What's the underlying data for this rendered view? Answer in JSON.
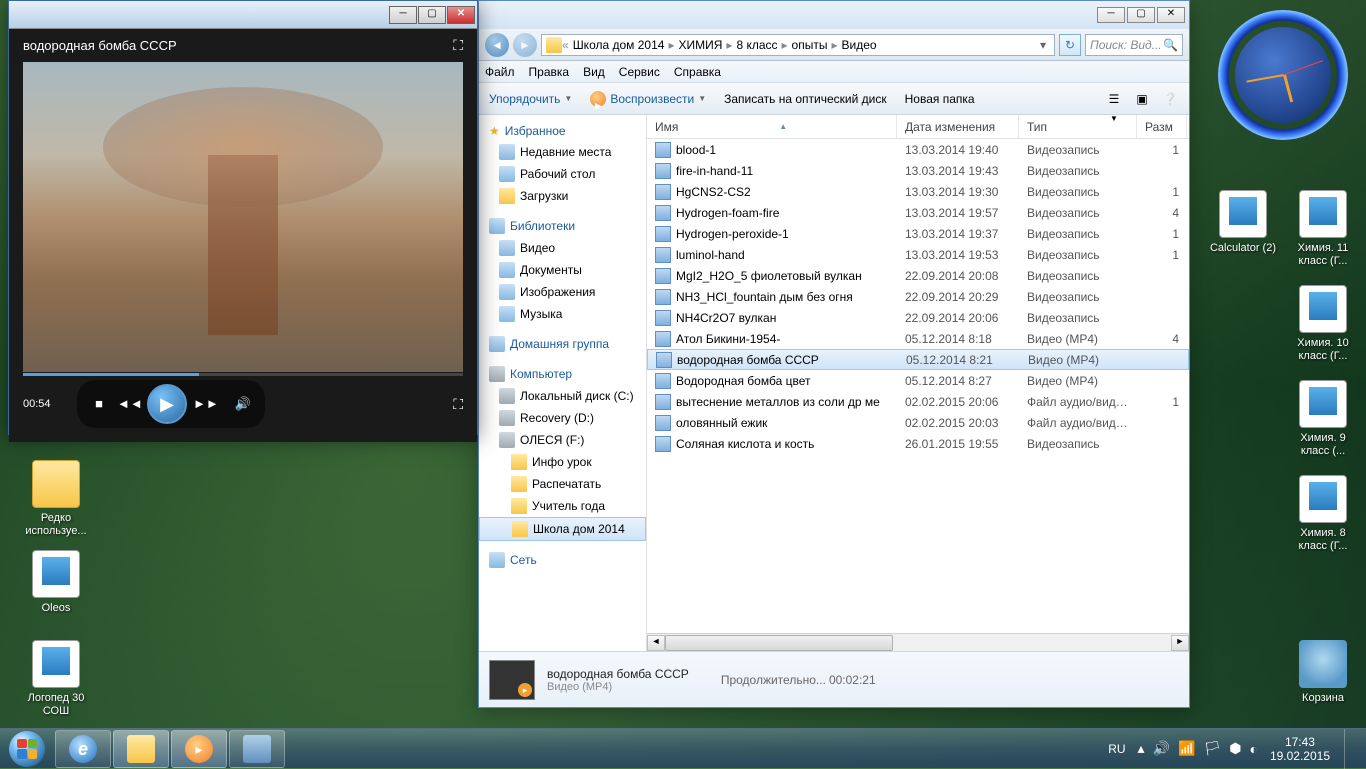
{
  "desktop_icons": {
    "rarely_used": "Редко используе...",
    "oleos": "Oleos",
    "logoped": "Логопед 30 СОШ",
    "calculator": "Calculator (2)",
    "chem11": "Химия. 11 класс (Г...",
    "chem10": "Химия. 10 класс (Г...",
    "chem9": "Химия. 9 класс (...",
    "chem8": "Химия. 8 класс (Г...",
    "recycle": "Корзина"
  },
  "wmp": {
    "title": "водородная бомба СССР",
    "time": "00:54"
  },
  "explorer": {
    "breadcrumbs": [
      "Школа дом 2014",
      "ХИМИЯ",
      "8 класс",
      "опыты",
      "Видео"
    ],
    "search_placeholder": "Поиск: Вид...",
    "menu": [
      "Файл",
      "Правка",
      "Вид",
      "Сервис",
      "Справка"
    ],
    "toolbar": {
      "organize": "Упорядочить",
      "play": "Воспроизвести",
      "burn": "Записать на оптический диск",
      "new_folder": "Новая папка"
    },
    "tree": {
      "favorites": "Избранное",
      "recent": "Недавние места",
      "desktop": "Рабочий стол",
      "downloads": "Загрузки",
      "libraries": "Библиотеки",
      "video": "Видео",
      "documents": "Документы",
      "pictures": "Изображения",
      "music": "Музыка",
      "homegroup": "Домашняя группа",
      "computer": "Компьютер",
      "drive_c": "Локальный диск (C:)",
      "drive_d": "Recovery (D:)",
      "drive_f": "ОЛЕСЯ (F:)",
      "f1": "Инфо урок",
      "f2": "Распечатать",
      "f3": "Учитель года",
      "f4": "Школа дом 2014",
      "network": "Сеть"
    },
    "cols": {
      "name": "Имя",
      "date": "Дата изменения",
      "type": "Тип",
      "size": "Разм"
    },
    "files": [
      {
        "name": "blood-1",
        "date": "13.03.2014 19:40",
        "type": "Видеозапись",
        "size": "1"
      },
      {
        "name": "fire-in-hand-11",
        "date": "13.03.2014 19:43",
        "type": "Видеозапись",
        "size": ""
      },
      {
        "name": "HgCNS2-CS2",
        "date": "13.03.2014 19:30",
        "type": "Видеозапись",
        "size": "1"
      },
      {
        "name": "Hydrogen-foam-fire",
        "date": "13.03.2014 19:57",
        "type": "Видеозапись",
        "size": "4"
      },
      {
        "name": "Hydrogen-peroxide-1",
        "date": "13.03.2014 19:37",
        "type": "Видеозапись",
        "size": "1"
      },
      {
        "name": "luminol-hand",
        "date": "13.03.2014 19:53",
        "type": "Видеозапись",
        "size": "1"
      },
      {
        "name": "MgI2_H2O_5 фиолетовый вулкан",
        "date": "22.09.2014 20:08",
        "type": "Видеозапись",
        "size": ""
      },
      {
        "name": "NH3_HCl_fountain дым без огня",
        "date": "22.09.2014 20:29",
        "type": "Видеозапись",
        "size": ""
      },
      {
        "name": "NH4Cr2O7  вулкан",
        "date": "22.09.2014 20:06",
        "type": "Видеозапись",
        "size": ""
      },
      {
        "name": "Атол Бикини-1954-",
        "date": "05.12.2014 8:18",
        "type": "Видео (MP4)",
        "size": "4"
      },
      {
        "name": "водородная бомба СССР",
        "date": "05.12.2014 8:21",
        "type": "Видео (MP4)",
        "size": "",
        "sel": true
      },
      {
        "name": "Водородная бомба цвет",
        "date": "05.12.2014 8:27",
        "type": "Видео (MP4)",
        "size": ""
      },
      {
        "name": "вытеснение металлов из соли др ме",
        "date": "02.02.2015 20:06",
        "type": "Файл аудио/виде...",
        "size": "1"
      },
      {
        "name": "оловянный ежик",
        "date": "02.02.2015 20:03",
        "type": "Файл аудио/виде...",
        "size": ""
      },
      {
        "name": "Соляная кислота и кость",
        "date": "26.01.2015 19:55",
        "type": "Видеозапись",
        "size": ""
      }
    ],
    "details": {
      "name": "водородная бомба СССР",
      "type": "Видео (MP4)",
      "duration_label": "Продолжительно...",
      "duration": "00:02:21"
    }
  },
  "tray": {
    "lang": "RU",
    "time": "17:43",
    "date": "19.02.2015"
  }
}
